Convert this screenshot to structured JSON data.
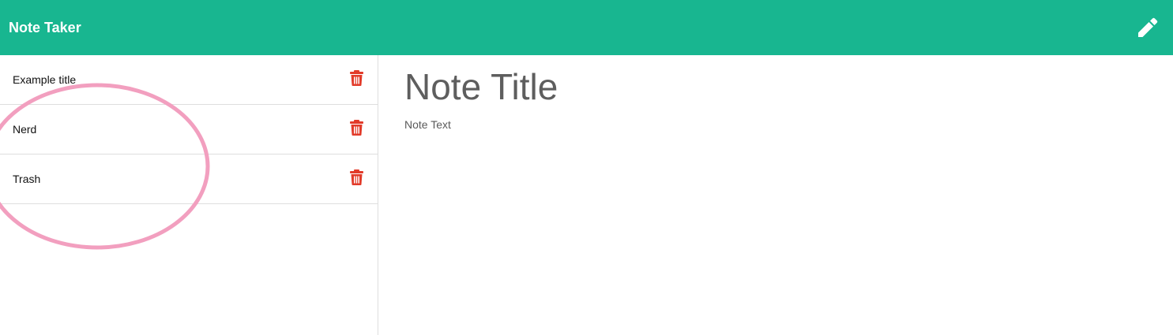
{
  "app": {
    "brand": "Note Taker",
    "accent_color": "#18b690",
    "new_note_icon": "pencil-icon"
  },
  "notes": [
    {
      "title": "Example title",
      "delete_icon": "trash-icon"
    },
    {
      "title": "Nerd",
      "delete_icon": "trash-icon"
    },
    {
      "title": "Trash",
      "delete_icon": "trash-icon"
    }
  ],
  "editor": {
    "title_placeholder": "Note Title",
    "text_placeholder": "Note Text"
  },
  "annotation": {
    "color": "#f29fbf",
    "shape": "ellipse"
  },
  "delete_color": "#e23b2a"
}
